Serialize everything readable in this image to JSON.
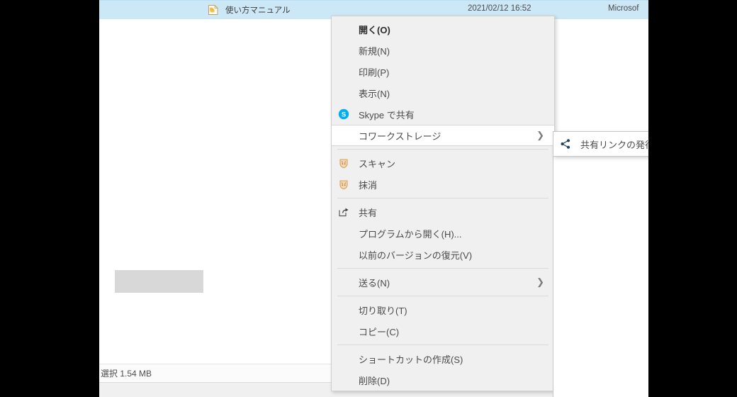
{
  "window": {
    "file_row": {
      "icon": "pdf-document-icon",
      "name": "使い方マニュアル",
      "date": "2021/02/12 16:52",
      "type": "Microsof"
    },
    "status_bar": {
      "text": "選択  1.54 MB"
    }
  },
  "context_menu": {
    "groups": [
      {
        "items": [
          {
            "label": "開く(O)",
            "icon": null,
            "bold": true,
            "arrow": false,
            "highlighted": false
          },
          {
            "label": "新規(N)",
            "icon": null,
            "bold": false,
            "arrow": false,
            "highlighted": false
          },
          {
            "label": "印刷(P)",
            "icon": null,
            "bold": false,
            "arrow": false,
            "highlighted": false
          },
          {
            "label": "表示(N)",
            "icon": null,
            "bold": false,
            "arrow": false,
            "highlighted": false
          },
          {
            "label": "Skype で共有",
            "icon": "skype-icon",
            "bold": false,
            "arrow": false,
            "highlighted": false
          },
          {
            "label": "コワークストレージ",
            "icon": null,
            "bold": false,
            "arrow": true,
            "highlighted": true
          }
        ]
      },
      {
        "items": [
          {
            "label": "スキャン",
            "icon": "shield-scan-icon",
            "bold": false,
            "arrow": false,
            "highlighted": false
          },
          {
            "label": "抹消",
            "icon": "shield-erase-icon",
            "bold": false,
            "arrow": false,
            "highlighted": false
          }
        ]
      },
      {
        "items": [
          {
            "label": "共有",
            "icon": "share-arrow-icon",
            "bold": false,
            "arrow": false,
            "highlighted": false
          },
          {
            "label": "プログラムから開く(H)...",
            "icon": null,
            "bold": false,
            "arrow": false,
            "highlighted": false
          },
          {
            "label": "以前のバージョンの復元(V)",
            "icon": null,
            "bold": false,
            "arrow": false,
            "highlighted": false
          }
        ]
      },
      {
        "items": [
          {
            "label": "送る(N)",
            "icon": null,
            "bold": false,
            "arrow": true,
            "highlighted": false
          }
        ]
      },
      {
        "items": [
          {
            "label": "切り取り(T)",
            "icon": null,
            "bold": false,
            "arrow": false,
            "highlighted": false
          },
          {
            "label": "コピー(C)",
            "icon": null,
            "bold": false,
            "arrow": false,
            "highlighted": false
          }
        ]
      },
      {
        "items": [
          {
            "label": "ショートカットの作成(S)",
            "icon": null,
            "bold": false,
            "arrow": false,
            "highlighted": false
          },
          {
            "label": "削除(D)",
            "icon": null,
            "bold": false,
            "arrow": false,
            "highlighted": false
          }
        ]
      }
    ]
  },
  "submenu": {
    "items": [
      {
        "label": "共有リンクの発行...",
        "icon": "share-node-icon"
      }
    ]
  },
  "colors": {
    "selection_blue": "#cce8f6",
    "menu_background": "#f0f0f0",
    "submenu_background": "#ffffff",
    "skype_blue": "#00aff0",
    "scan_icon_orange": "#e8a33d",
    "letterbox_black": "#000000"
  }
}
